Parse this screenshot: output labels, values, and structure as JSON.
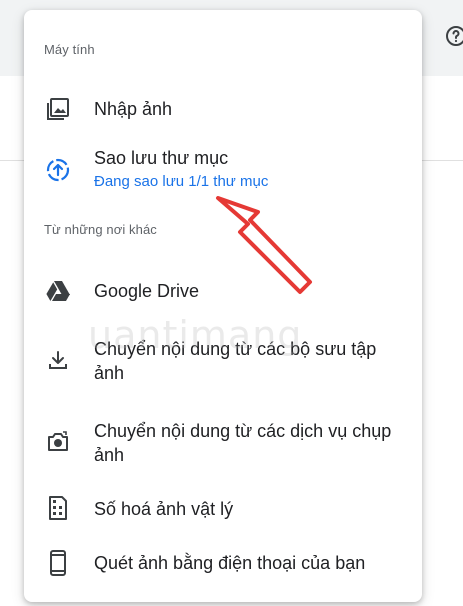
{
  "menu": {
    "sections": [
      {
        "header": "Máy tính"
      },
      {
        "header": "Từ những nơi khác"
      }
    ],
    "items": [
      {
        "label": "Nhập ảnh",
        "icon": "photo-import-icon"
      },
      {
        "label": "Sao lưu thư mục",
        "sublabel": "Đang sao lưu 1/1 thư mục",
        "icon": "backup-upload-icon"
      },
      {
        "label": "Google Drive",
        "icon": "google-drive-icon"
      },
      {
        "label": "Chuyển nội dung từ các bộ sưu tập ảnh",
        "icon": "download-icon"
      },
      {
        "label": "Chuyển nội dung từ các dịch vụ chụp ảnh",
        "icon": "camera-transfer-icon"
      },
      {
        "label": "Số hoá ảnh vật lý",
        "icon": "film-digitize-icon"
      },
      {
        "label": "Quét ảnh bằng điện thoại của bạn",
        "icon": "phone-icon"
      }
    ]
  },
  "colors": {
    "accent": "#1a73e8",
    "annotation": "#e53935",
    "text": "#202124",
    "muted": "#5f6368"
  },
  "watermark": {
    "text": "uantimang"
  }
}
